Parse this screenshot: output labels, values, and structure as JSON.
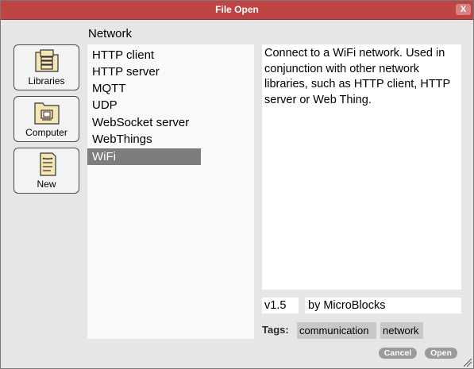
{
  "window": {
    "title": "File Open",
    "close_label": "X"
  },
  "folder": {
    "title": "Network"
  },
  "nav": {
    "items": [
      {
        "label": "Libraries",
        "icon": "library-books-icon"
      },
      {
        "label": "Computer",
        "icon": "computer-folder-icon"
      },
      {
        "label": "New",
        "icon": "new-document-icon"
      }
    ]
  },
  "files": {
    "items": [
      "HTTP client",
      "HTTP server",
      "MQTT",
      "UDP",
      "WebSocket server",
      "WebThings",
      "WiFi"
    ],
    "selected": "WiFi"
  },
  "details": {
    "description": "Connect to a WiFi network. Used in conjunction with other network libraries, such as HTTP client, HTTP server or Web Thing.",
    "version": "v1.5",
    "author": "by MicroBlocks",
    "tags_label": "Tags:",
    "tags": [
      "communication",
      "network"
    ]
  },
  "buttons": {
    "cancel_label": "Cancel",
    "open_label": "Open"
  },
  "colors": {
    "titlebar": "#bf4545",
    "selection": "#7d7d7d",
    "dialog_bg": "#e6e6e6"
  }
}
